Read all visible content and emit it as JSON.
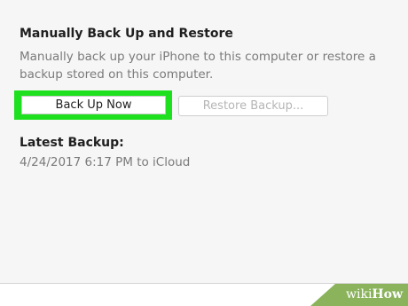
{
  "backup": {
    "title": "Manually Back Up and Restore",
    "description": "Manually back up your iPhone to this computer or restore a backup stored on this computer.",
    "back_up_now_label": "Back Up Now",
    "restore_backup_label": "Restore Backup...",
    "highlight_color": "#1fe01f"
  },
  "latest": {
    "title": "Latest Backup:",
    "value": "4/24/2017 6:17 PM to iCloud"
  },
  "watermark": {
    "wiki": "wiki",
    "how": "How",
    "color": "#8ab35c"
  }
}
